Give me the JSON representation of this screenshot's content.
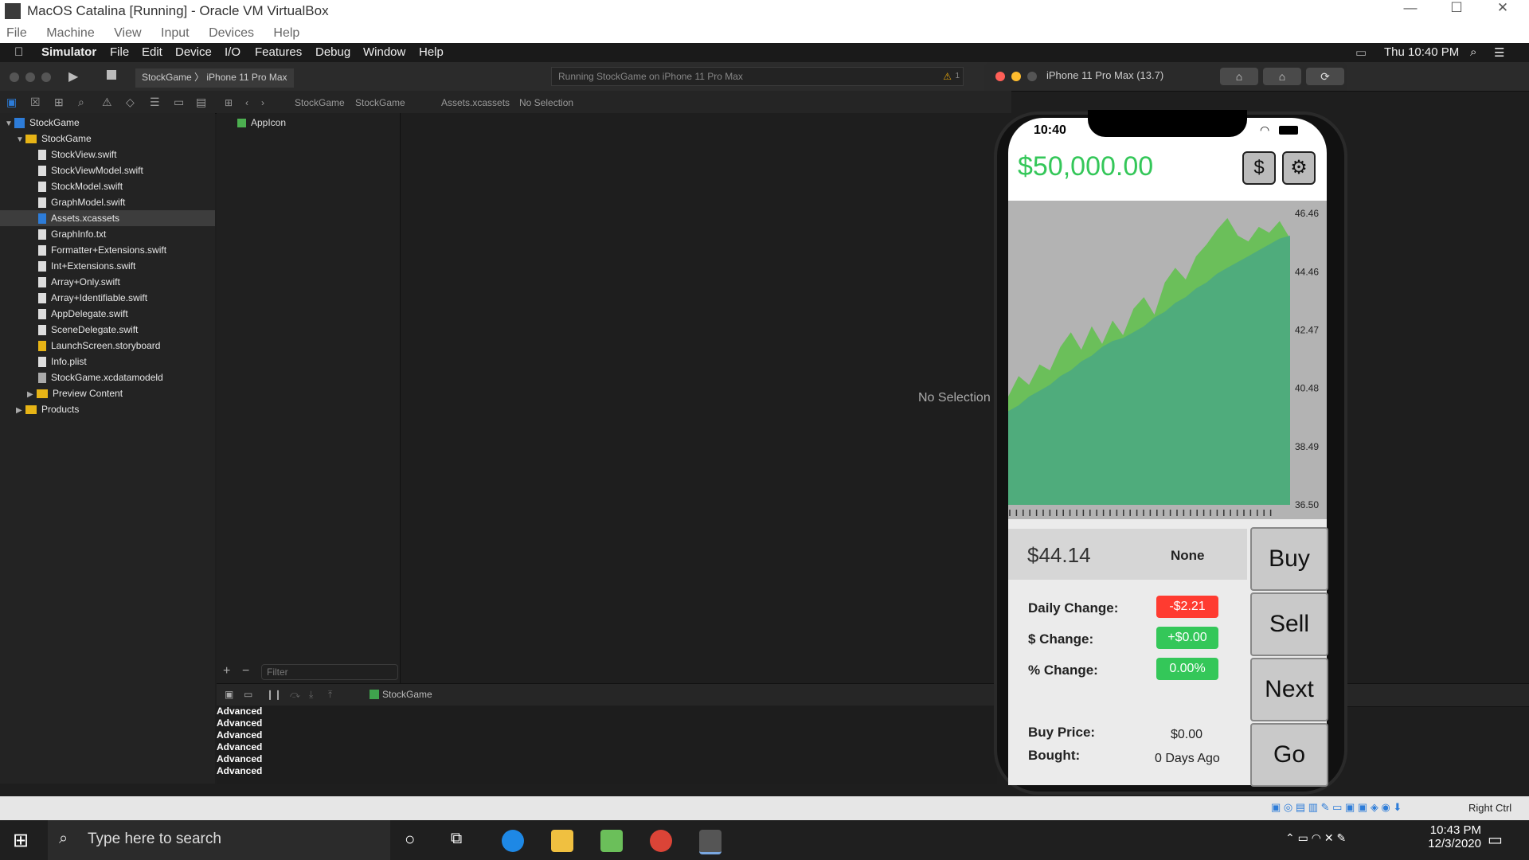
{
  "vbox": {
    "title": "MacOS Catalina [Running] - Oracle VM VirtualBox",
    "minimize": "—",
    "maximize": "☐",
    "close": "✕",
    "menu": [
      "File",
      "Machine",
      "View",
      "Input",
      "Devices",
      "Help"
    ],
    "host_key": "Right Ctrl"
  },
  "mac_menu": {
    "app": "Simulator",
    "items": [
      "File",
      "Edit",
      "Device",
      "I/O",
      "Features",
      "Debug",
      "Window",
      "Help"
    ],
    "clock": "Thu 10:40 PM"
  },
  "xcode": {
    "scheme": "StockGame",
    "destination": "iPhone 11 Pro Max",
    "status": "Running StockGame on iPhone 11 Pro Max",
    "warning_count": "1",
    "breadcrumb": [
      "StockGame",
      "StockGame",
      "Assets.xcassets",
      "No Selection"
    ],
    "navigator": [
      {
        "label": "StockGame",
        "type": "project",
        "level": 0,
        "open": true
      },
      {
        "label": "StockGame",
        "type": "folder",
        "level": 1,
        "open": true
      },
      {
        "label": "StockView.swift",
        "type": "file",
        "level": 2
      },
      {
        "label": "StockViewModel.swift",
        "type": "file",
        "level": 2
      },
      {
        "label": "StockModel.swift",
        "type": "file",
        "level": 2
      },
      {
        "label": "GraphModel.swift",
        "type": "file",
        "level": 2
      },
      {
        "label": "Assets.xcassets",
        "type": "assets",
        "level": 2,
        "selected": true
      },
      {
        "label": "GraphInfo.txt",
        "type": "file",
        "level": 2
      },
      {
        "label": "Formatter+Extensions.swift",
        "type": "file",
        "level": 2
      },
      {
        "label": "Int+Extensions.swift",
        "type": "file",
        "level": 2
      },
      {
        "label": "Array+Only.swift",
        "type": "file",
        "level": 2
      },
      {
        "label": "Array+Identifiable.swift",
        "type": "file",
        "level": 2
      },
      {
        "label": "AppDelegate.swift",
        "type": "file",
        "level": 2
      },
      {
        "label": "SceneDelegate.swift",
        "type": "file",
        "level": 2
      },
      {
        "label": "LaunchScreen.storyboard",
        "type": "file",
        "level": 2
      },
      {
        "label": "Info.plist",
        "type": "file",
        "level": 2
      },
      {
        "label": "StockGame.xcdatamodeld",
        "type": "file",
        "level": 2
      },
      {
        "label": "Preview Content",
        "type": "folder",
        "level": 2,
        "open": false
      },
      {
        "label": "Products",
        "type": "folder",
        "level": 1,
        "open": false
      }
    ],
    "asset_item": "AppIcon",
    "no_selection": "No Selection",
    "filter_placeholder": "Filter",
    "debug_target": "StockGame",
    "console_lines": [
      "Advanced",
      "Advanced",
      "Advanced",
      "Advanced",
      "Advanced",
      "Advanced"
    ]
  },
  "simulator": {
    "title": "iPhone 11 Pro Max (13.7)",
    "status_time": "10:40",
    "balance": "$50,000.00",
    "dollar_button": "$",
    "settings_button": "⚙",
    "price": "$44.14",
    "position": "None",
    "daily_change_label": "Daily Change:",
    "daily_change": "-$2.21",
    "dollar_change_label": "$ Change:",
    "dollar_change": "+$0.00",
    "percent_change_label": "% Change:",
    "percent_change": "0.00%",
    "buy_price_label": "Buy Price:",
    "buy_price": "$0.00",
    "bought_label": "Bought:",
    "bought": "0 Days Ago",
    "actions": [
      "Buy",
      "Sell",
      "Next",
      "Go"
    ],
    "colors": {
      "positive": "#34c759",
      "negative": "#ff3b30"
    }
  },
  "chart_data": {
    "type": "area",
    "y_ticks": [
      "46.46",
      "44.46",
      "42.47",
      "40.48",
      "38.49",
      "36.50"
    ],
    "ylim": [
      36.5,
      46.46
    ],
    "series": [
      {
        "values": [
          40.2,
          40.9,
          40.6,
          41.3,
          41.1,
          41.9,
          42.4,
          41.8,
          42.6,
          42.0,
          42.8,
          42.3,
          43.2,
          43.6,
          43.0,
          44.1,
          44.6,
          44.2,
          45.0,
          45.4,
          45.9,
          46.3,
          45.7,
          45.5,
          46.0,
          45.8,
          46.2,
          45.6
        ]
      },
      {
        "values": [
          39.7,
          39.9,
          40.2,
          40.4,
          40.6,
          40.9,
          41.1,
          41.4,
          41.6,
          41.9,
          42.1,
          42.2,
          42.4,
          42.6,
          42.9,
          43.1,
          43.4,
          43.6,
          43.9,
          44.1,
          44.4,
          44.6,
          44.8,
          45.0,
          45.2,
          45.4,
          45.6,
          45.7
        ]
      }
    ],
    "series_colors": [
      "#6bbf5a",
      "#4aa882"
    ]
  },
  "windows": {
    "search_placeholder": "Type here to search",
    "time": "10:43 PM",
    "date": "12/3/2020"
  }
}
